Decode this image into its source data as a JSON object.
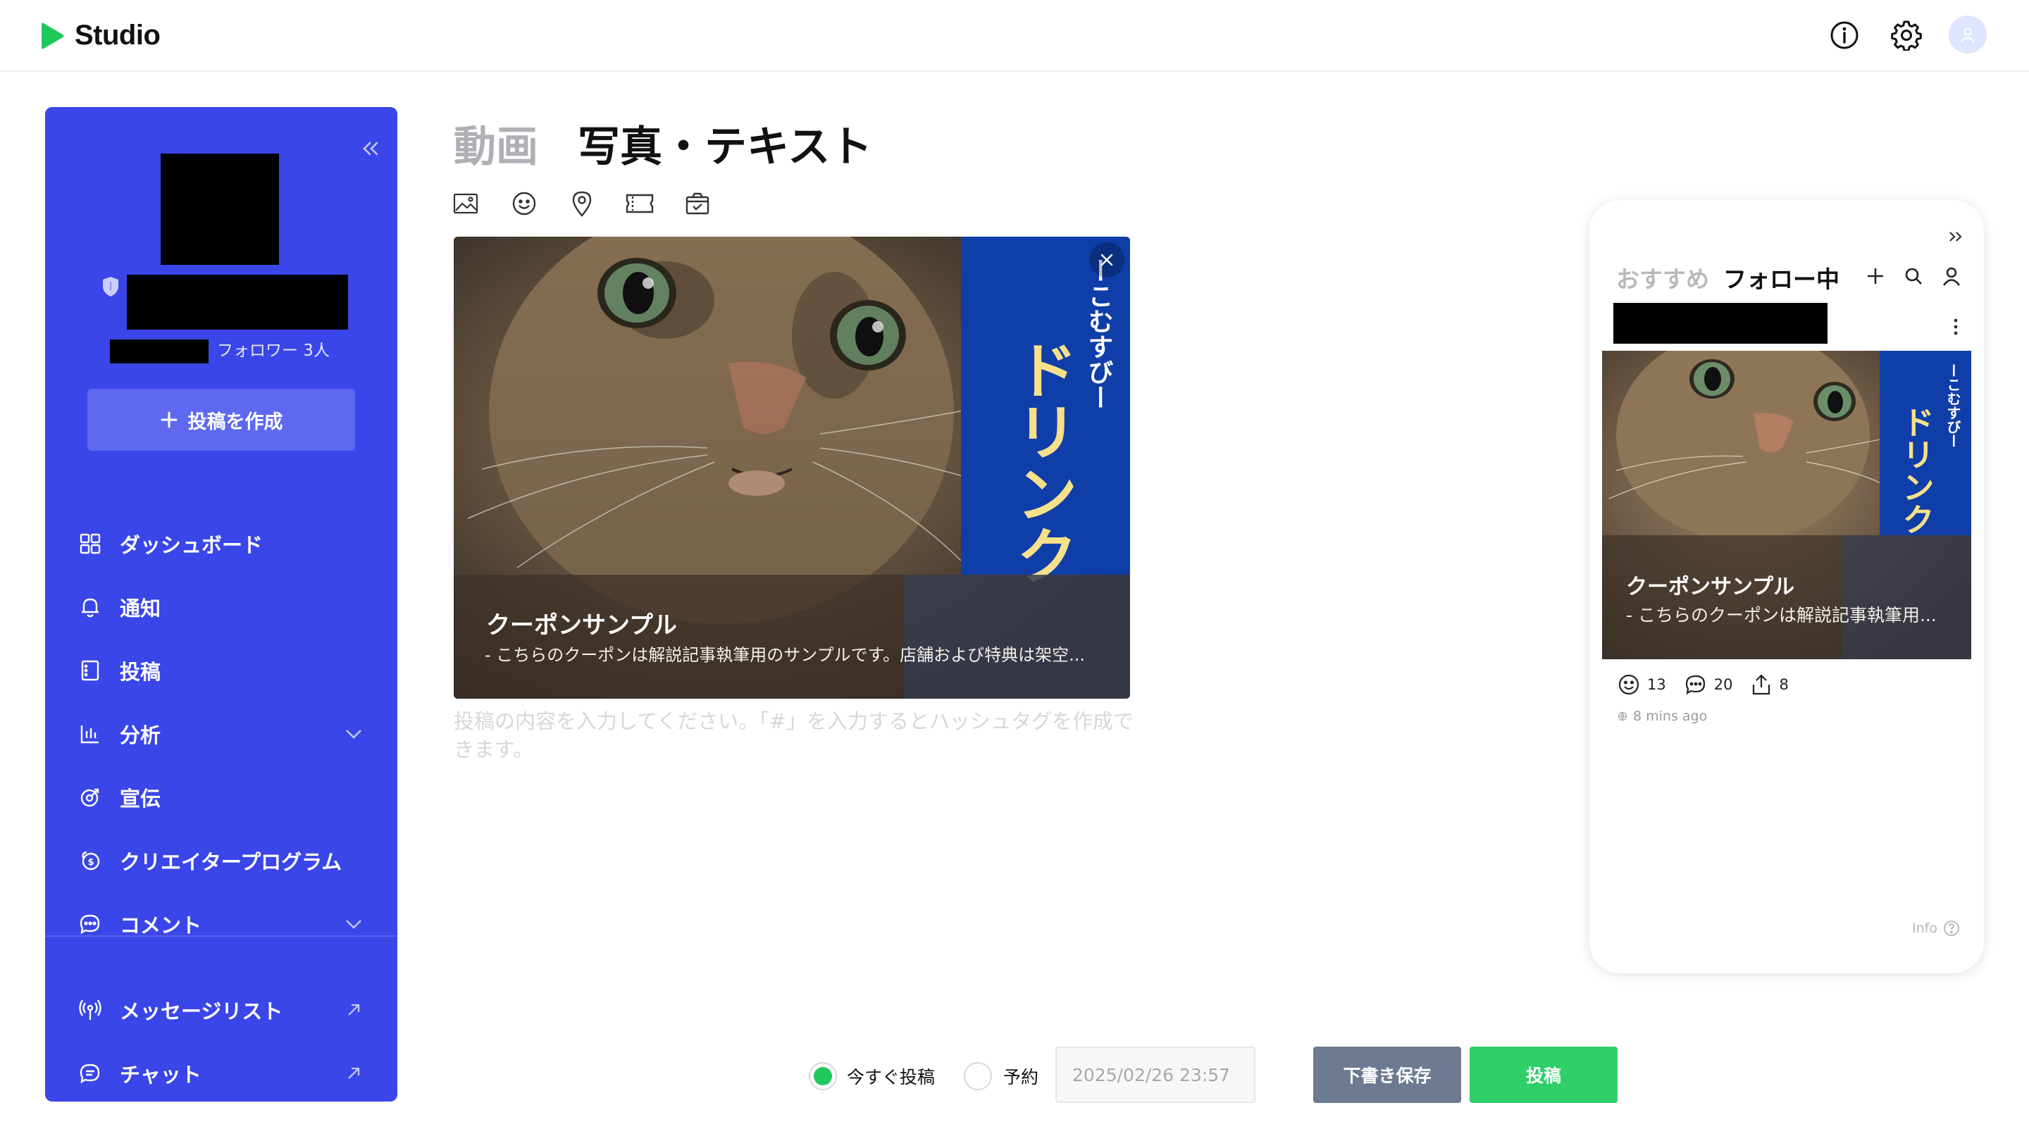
{
  "app": {
    "name": "Studio",
    "brand_color": "#1fc95c",
    "sidebar_color": "#3a46e7"
  },
  "header": {
    "icons": [
      "info-icon",
      "gear-icon",
      "user-avatar"
    ]
  },
  "sidebar": {
    "follower_text": "フォロワー 3人",
    "create_label": "投稿を作成",
    "items": [
      {
        "label": "ダッシュボード",
        "icon": "dashboard-icon"
      },
      {
        "label": "通知",
        "icon": "bell-icon"
      },
      {
        "label": "投稿",
        "icon": "post-icon"
      },
      {
        "label": "分析",
        "icon": "chart-icon",
        "trail": "chevron-down-icon"
      },
      {
        "label": "宣伝",
        "icon": "promote-icon"
      },
      {
        "label": "クリエイタープログラム",
        "icon": "coin-icon"
      },
      {
        "label": "コメント",
        "icon": "comment-icon",
        "trail": "chevron-down-icon"
      },
      {
        "label": "メッセージリスト",
        "icon": "broadcast-icon",
        "trail": "external-link-icon"
      },
      {
        "label": "チャット",
        "icon": "chat-icon",
        "trail": "external-link-icon"
      }
    ]
  },
  "editor": {
    "tabs": {
      "video": "動画",
      "photo_text": "写真・テキスト"
    },
    "toolbar_icons": [
      "image-icon",
      "emoji-icon",
      "location-icon",
      "coupon-icon",
      "shopping-bag-icon"
    ],
    "card": {
      "title": "クーポンサンプル",
      "description": "- こちらのクーポンは解説記事執筆用のサンプルです。店舗および特典は架空...",
      "banner_text": "ドリンク",
      "banner_subtext": "ーこむすびー"
    },
    "placeholder": "投稿の内容を入力してください。「#」を入力するとハッシュタグを作成できます。"
  },
  "footer": {
    "now_label": "今すぐ投稿",
    "schedule_label": "予約",
    "datetime_placeholder": "2025/02/26 23:57",
    "draft_label": "下書き保存",
    "post_label": "投稿"
  },
  "preview": {
    "tabs": {
      "recommended": "おすすめ",
      "following": "フォロー中"
    },
    "card": {
      "title": "クーポンサンプル",
      "description": "- こちらのクーポンは解説記事執筆用...",
      "banner_text": "ドリンク",
      "banner_subtext": "ーこむすびー"
    },
    "stats": {
      "reactions": "13",
      "comments": "20",
      "shares": "8"
    },
    "time": "8 mins ago",
    "info_label": "Info"
  }
}
